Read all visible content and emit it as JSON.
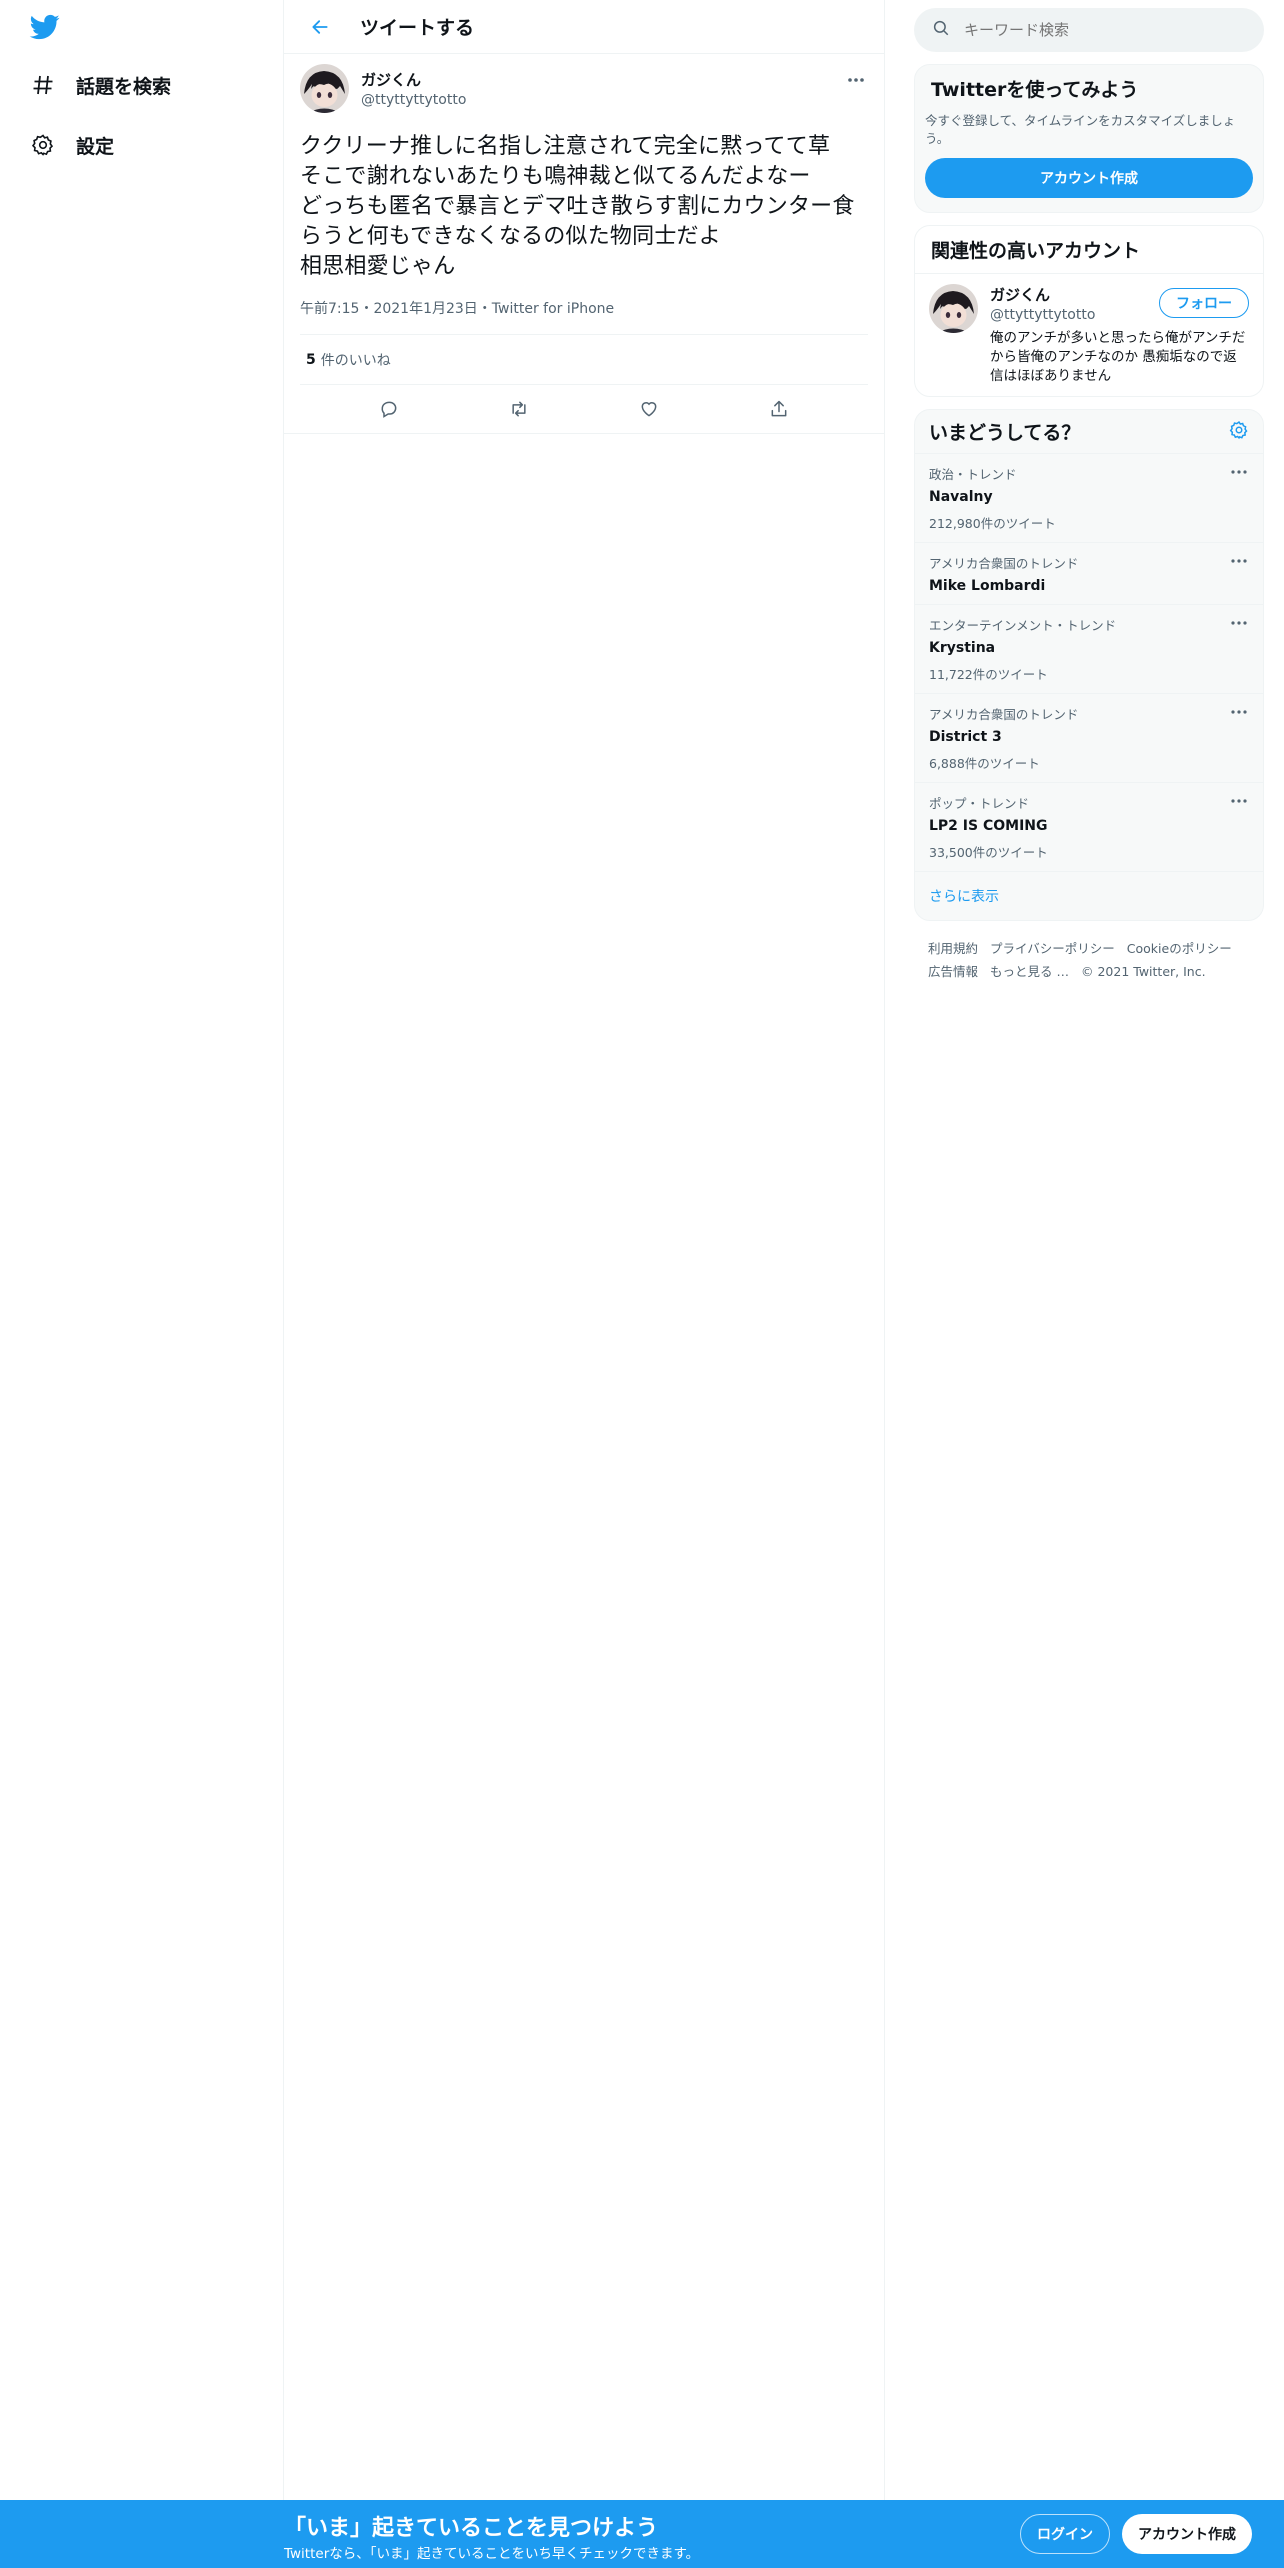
{
  "nav": {
    "items": [
      {
        "label": "話題を検索",
        "icon": "hashtag-icon"
      },
      {
        "label": "設定",
        "icon": "gear-icon"
      }
    ]
  },
  "header": {
    "title": "ツイートする"
  },
  "tweet": {
    "author_name": "ガジくん",
    "author_handle": "@ttyttyttytotto",
    "text": "ククリーナ推しに名指し注意されて完全に黙ってて草\nそこで謝れないあたりも鳴神裁と似てるんだよなー\nどっちも匿名で暴言とデマ吐き散らす割にカウンター食らうと何もできなくなるの似た物同士だよ\n相思相愛じゃん",
    "meta": "午前7:15・2021年1月23日・Twitter for iPhone",
    "likes_count": "5",
    "likes_label": "件のいいね"
  },
  "search": {
    "placeholder": "キーワード検索"
  },
  "signup_card": {
    "title": "Twitterを使ってみよう",
    "desc": "今すぐ登録して、タイムラインをカスタマイズしましょう。",
    "button": "アカウント作成"
  },
  "related": {
    "title": "関連性の高いアカウント",
    "name": "ガジくん",
    "handle": "@ttyttyttytotto",
    "follow": "フォロー",
    "bio": "俺のアンチが多いと思ったら俺がアンチだから皆俺のアンチなのか 愚痴垢なので返信はほぼありません"
  },
  "trends": {
    "title": "いまどうしてる？",
    "items": [
      {
        "category": "政治・トレンド",
        "name": "Navalny",
        "count": "212,980件のツイート"
      },
      {
        "category": "アメリカ合衆国のトレンド",
        "name": "Mike Lombardi",
        "count": ""
      },
      {
        "category": "エンターテインメント・トレンド",
        "name": "Krystina",
        "count": "11,722件のツイート"
      },
      {
        "category": "アメリカ合衆国のトレンド",
        "name": "District 3",
        "count": "6,888件のツイート"
      },
      {
        "category": "ポップ・トレンド",
        "name": "LP2 IS COMING",
        "count": "33,500件のツイート"
      }
    ],
    "show_more": "さらに表示"
  },
  "footer": {
    "links": [
      "利用規約",
      "プライバシーポリシー",
      "Cookieのポリシー",
      "広告情報",
      "もっと見る …"
    ],
    "copyright": "© 2021 Twitter, Inc."
  },
  "bottombar": {
    "title": "「いま」起きていることを見つけよう",
    "subtitle": "Twitterなら、「いま」起きていることをいち早くチェックできます。",
    "login": "ログイン",
    "signup": "アカウント作成"
  },
  "colors": {
    "accent": "#1d9bf0",
    "text": "#0f1419",
    "secondary": "#536471",
    "border": "#eff3f4"
  }
}
